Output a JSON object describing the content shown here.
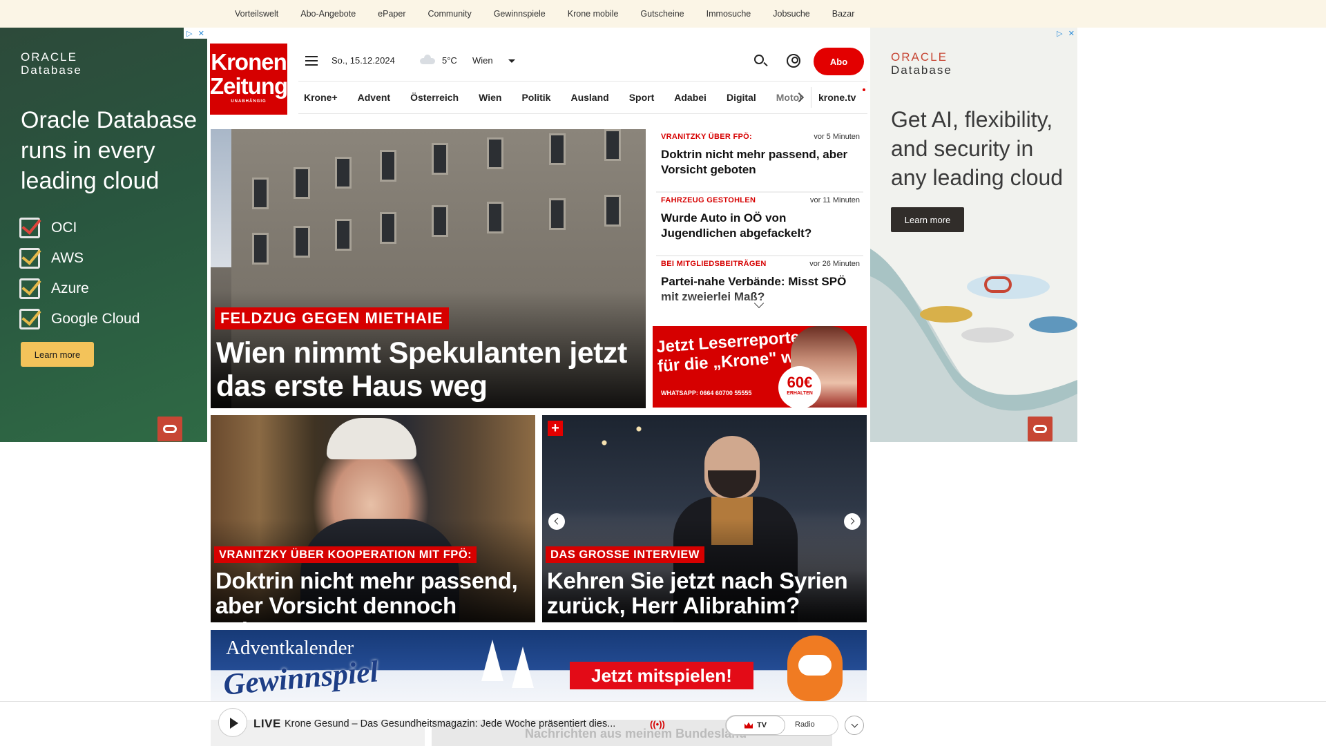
{
  "top_links": [
    "Vorteilswelt",
    "Abo-Angebote",
    "ePaper",
    "Community",
    "Gewinnspiele",
    "Krone mobile",
    "Gutscheine",
    "Immosuche",
    "Jobsuche",
    "Bazar"
  ],
  "ad_left": {
    "brand_line1": "ORACLE",
    "brand_line2": "Database",
    "headline": "Oracle Database runs in every leading cloud",
    "clouds": [
      "OCI",
      "AWS",
      "Azure",
      "Google Cloud"
    ],
    "cta": "Learn more"
  },
  "ad_right": {
    "brand_line1": "ORACLE",
    "brand_line2": "Database",
    "headline": "Get AI, flexibility, and security in any leading cloud",
    "cta": "Learn more"
  },
  "logo": {
    "line1": "Kronen",
    "line2": "Zeitung",
    "tagline": "UNABHÄNGIG"
  },
  "header": {
    "date": "So., 15.12.2024",
    "temperature": "5°C",
    "city": "Wien",
    "abo_label": "Abo"
  },
  "nav": {
    "items": [
      "Krone+",
      "Advent",
      "Österreich",
      "Wien",
      "Politik",
      "Ausland",
      "Sport",
      "Adabei",
      "Digital",
      "Motor"
    ],
    "tv": "krone.tv"
  },
  "hero": {
    "kicker": "FELDZUG GEGEN MIETHAIE",
    "title": "Wien nimmt Spekulanten jetzt das erste Haus weg"
  },
  "ticker": [
    {
      "kicker": "VRANITZKY ÜBER FPÖ:",
      "time": "vor 5 Minuten",
      "title": "Doktrin nicht mehr passend, aber Vorsicht geboten"
    },
    {
      "kicker": "FAHRZEUG GESTOHLEN",
      "time": "vor 11 Minuten",
      "title": "Wurde Auto in OÖ von Jugendlichen abgefackelt?"
    },
    {
      "kicker": "BEI MITGLIEDSBEITRÄGEN",
      "time": "vor 26 Minuten",
      "title": "Partei-nahe Verbände: Misst SPÖ mit zweierlei Maß?"
    }
  ],
  "reporter": {
    "title_line1": "Jetzt Leserreporter",
    "title_line2": "für die „Krone\" werden",
    "whatsapp": "WHATSAPP: 0664 60700 55555",
    "price": "60€",
    "price_note": "ERHALTEN"
  },
  "cards": [
    {
      "kicker": "VRANITZKY ÜBER KOOPERATION MIT FPÖ:",
      "title": "Doktrin nicht mehr passend, aber Vorsicht dennoch geboten"
    },
    {
      "kicker": "DAS GROSSE INTERVIEW",
      "title": "Kehren Sie jetzt nach Syrien zurück, Herr Alibrahim?",
      "badge": "+"
    }
  ],
  "advent": {
    "line1": "Adventkalender",
    "line2": "Gewinnspiel",
    "cta": "Jetzt mitspielen!"
  },
  "live": {
    "label": "LIVE",
    "text": "Krone Gesund – Das Gesundheitsmagazin: Jede Woche präsentiert dies...",
    "radio_icon": "((•))",
    "tv_label": "TV",
    "radio_label": "Radio",
    "behind_text": "Nachrichten aus meinem Bundesland"
  }
}
